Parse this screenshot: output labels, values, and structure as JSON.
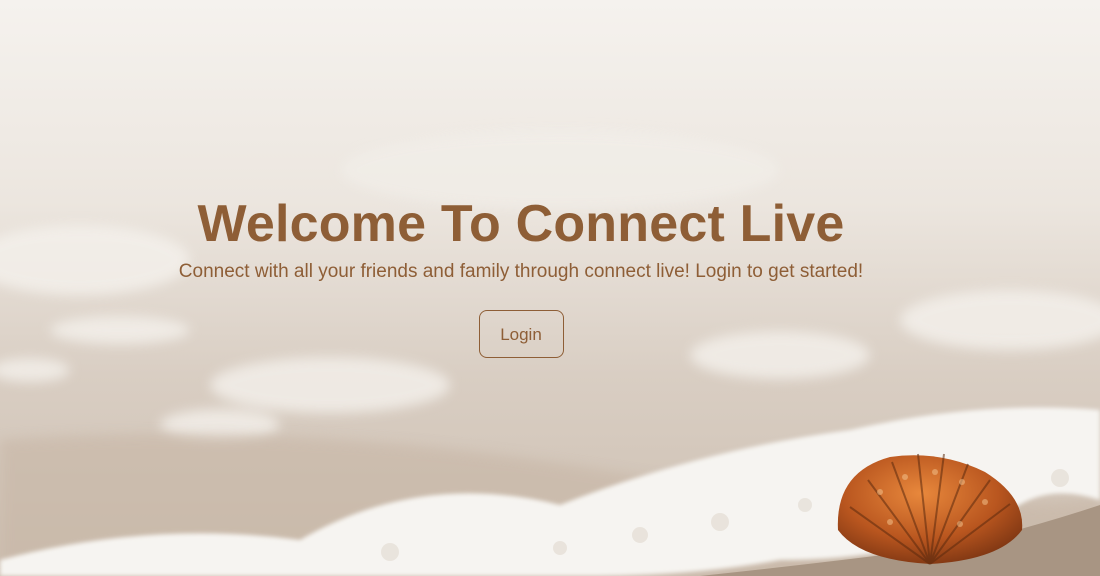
{
  "hero": {
    "title": "Welcome To Connect Live",
    "subtitle": "Connect with all your friends and family through connect live! Login to get started!",
    "login_label": "Login"
  },
  "colors": {
    "accent": "#8e5e36",
    "background_sand": "#d9cfc5",
    "foam": "#f4f1ec",
    "shell": "#c66b2c"
  },
  "icons": {
    "background": "beach-seashell-photo"
  }
}
